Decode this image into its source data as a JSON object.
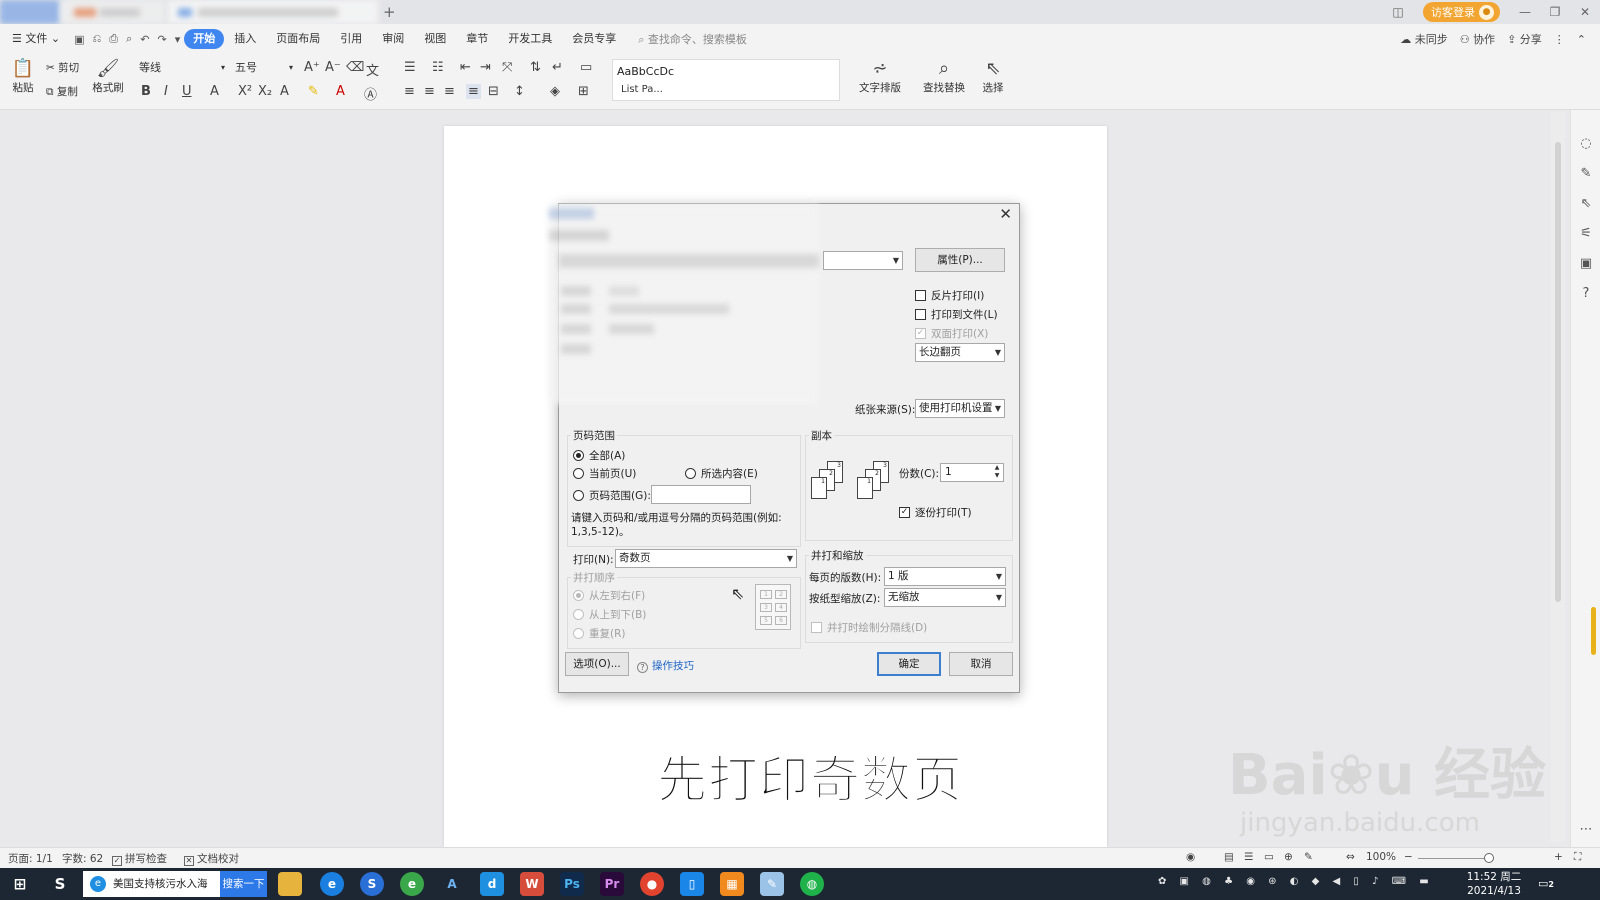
{
  "title_bar": {
    "visitor_login": "访客登录"
  },
  "menu": {
    "file": "文件",
    "tabs": [
      "开始",
      "插入",
      "页面布局",
      "引用",
      "审阅",
      "视图",
      "章节",
      "开发工具",
      "会员专享"
    ],
    "search_placeholder": "查找命令、搜索模板",
    "sync": "未同步",
    "collab": "协作",
    "share": "分享"
  },
  "ribbon": {
    "paste": "粘贴",
    "cut": "剪切",
    "copy": "复制",
    "format_painter": "格式刷",
    "font_name": "等线",
    "font_size": "五号",
    "style_preview": "AaBbCcDc",
    "style_name": "List Pa...",
    "text_layout": "文字排版",
    "find_replace": "查找替换",
    "select": "选择"
  },
  "dialog": {
    "properties_button": "属性(P)...",
    "reverse_print": "反片打印(I)",
    "print_to_file": "打印到文件(L)",
    "duplex": "双面打印(X)",
    "flip_option": "长边翻页",
    "paper_source_label": "纸张来源(S):",
    "paper_source_value": "使用打印机设置",
    "page_range": {
      "title": "页码范围",
      "all": "全部(A)",
      "current": "当前页(U)",
      "selection": "所选内容(E)",
      "range": "页码范围(G):",
      "hint": "请键入页码和/或用逗号分隔的页码范围(例如:",
      "hint2": "1,3,5-12)。"
    },
    "print_label": "打印(N):",
    "print_value": "奇数页",
    "collate_order": {
      "title": "并打顺序",
      "left_to_right": "从左到右(F)",
      "top_to_bottom": "从上到下(B)",
      "repeat": "重复(R)"
    },
    "copies": {
      "title": "副本",
      "count_label": "份数(C):",
      "count_value": "1",
      "collate": "逐份打印(T)"
    },
    "zoom": {
      "title": "并打和缩放",
      "per_page_label": "每页的版数(H):",
      "per_page_value": "1 版",
      "scale_label": "按纸型缩放(Z):",
      "scale_value": "无缩放",
      "draw_borders": "并打时绘制分隔线(D)"
    },
    "options_button": "选项(O)...",
    "tips_link": "操作技巧",
    "ok_button": "确定",
    "cancel_button": "取消"
  },
  "subtitle": "先打印奇数页",
  "watermark": {
    "brand": "Bai",
    "brand_cn": "经验",
    "url": "jingyan.baidu.com"
  },
  "status_bar": {
    "page": "页面: 1/1",
    "words": "字数: 62",
    "spell_check": "拼写检查",
    "doc_check": "文档校对",
    "zoom": "100%"
  },
  "taskbar": {
    "search_text": "美国支持核污水入海",
    "search_button": "搜索一下",
    "time": "11:52 周二",
    "date": "2021/4/13",
    "notifications": "2"
  },
  "colors": {
    "accent": "#3f86f1",
    "visitor": "#f2a530",
    "taskbar": "#1d2733"
  }
}
